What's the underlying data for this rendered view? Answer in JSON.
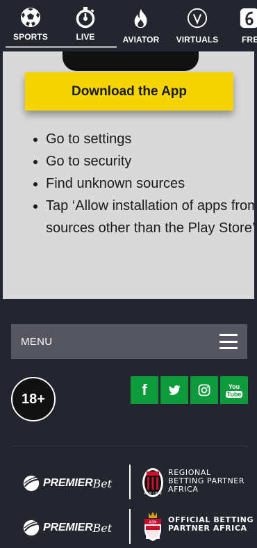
{
  "nav": {
    "items": [
      {
        "label": "SPORTS",
        "icon": "soccer-ball-icon"
      },
      {
        "label": "LIVE",
        "icon": "stopwatch-icon"
      },
      {
        "label": "AVIATOR",
        "icon": "flame-icon"
      },
      {
        "label": "VIRTUALS",
        "icon": "virtuals-v-icon"
      },
      {
        "label": "FRE",
        "icon": "number-six-icon"
      }
    ]
  },
  "download": {
    "button_label": "Download the App",
    "steps": [
      "Go to settings",
      "Go to security",
      "Find unknown sources",
      "Tap ‘Allow installation of apps from sources other than the Play Store’"
    ]
  },
  "menu": {
    "label": "MENU"
  },
  "age": {
    "label": "18+"
  },
  "social": {
    "facebook": "f",
    "youtube_top": "You",
    "youtube_bottom": "Tube"
  },
  "partners": [
    {
      "brand_a": "PREMIER",
      "brand_b": "Bet",
      "line1": "REGIONAL",
      "line2": "BETTING PARTNER",
      "line3": "AFRICA",
      "crest_text": "ACM 1899"
    },
    {
      "brand_a": "PREMIER",
      "brand_b": "Bet",
      "line1": "OFFICIAL BETTING",
      "line2": "PARTNER AFRICA",
      "crest_text": "ASM"
    }
  ],
  "colors": {
    "background": "#23252f",
    "download_bg": "#d9d9d9",
    "button_yellow": "#f5d400",
    "social_green": "#0d9a3c",
    "menu_bar": "#555660"
  }
}
